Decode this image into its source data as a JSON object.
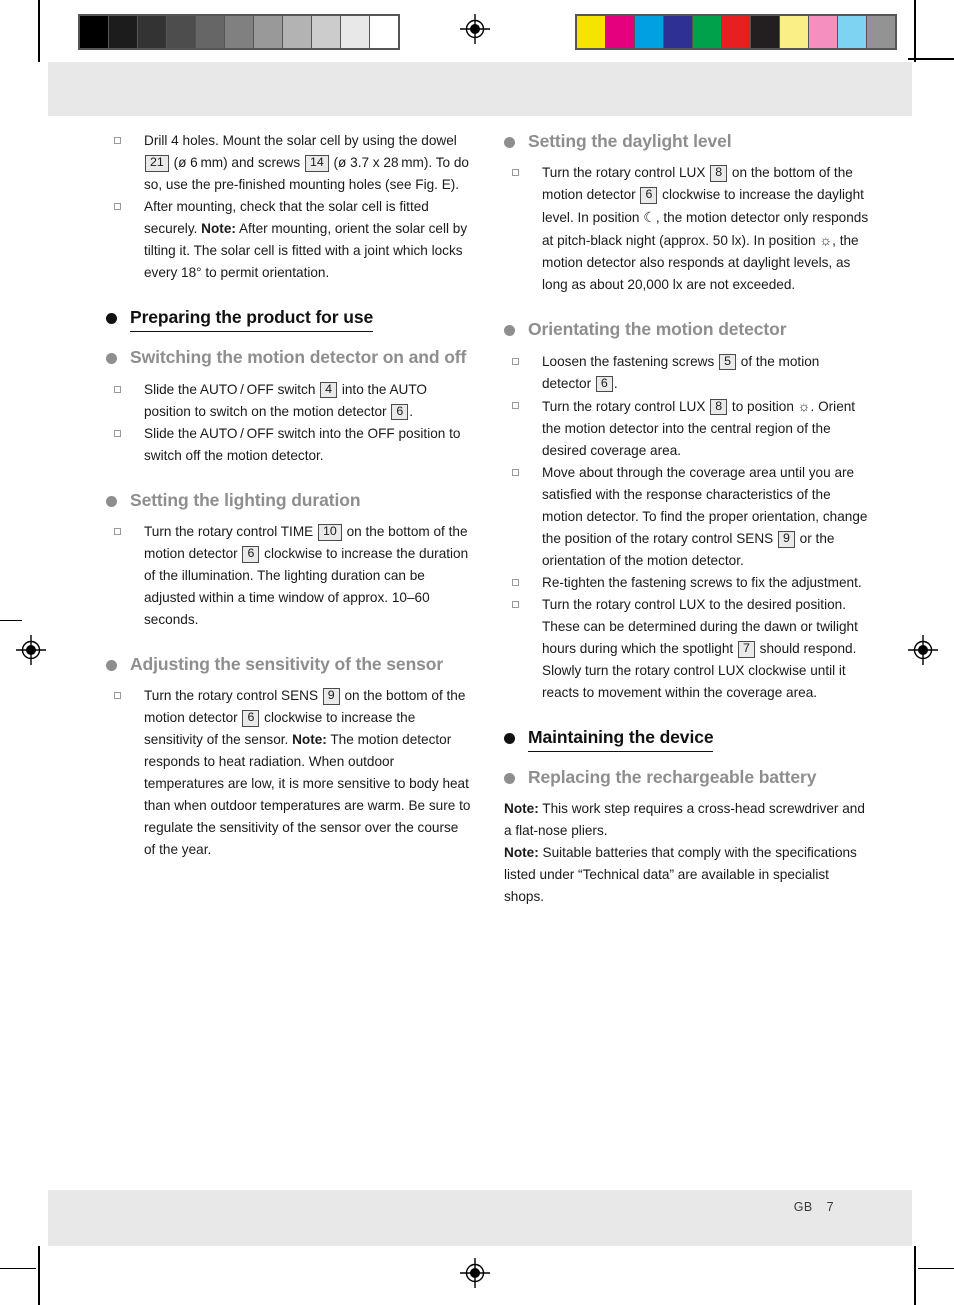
{
  "print_marks": {
    "gray_wedge": {
      "name": "grayscale-step-wedge",
      "swatches": [
        "#000000",
        "#1c1c1c",
        "#333333",
        "#4d4d4d",
        "#666666",
        "#808080",
        "#999999",
        "#b3b3b3",
        "#cccccc",
        "#e8e8e8",
        "#ffffff"
      ]
    },
    "color_bar": {
      "name": "cmyk-color-control-bar",
      "swatches": [
        "#f5e400",
        "#e5007d",
        "#00a0e3",
        "#2e3191",
        "#00a14b",
        "#e62020",
        "#231f20",
        "#faef86",
        "#f48fc0",
        "#7fd3f2",
        "#939393"
      ]
    },
    "registration_mark": "registration-target"
  },
  "left_column": [
    {
      "type": "list",
      "items": [
        {
          "segments": [
            {
              "t": "Drill 4 holes. Mount the solar cell by using the dowel "
            },
            {
              "ref": "21"
            },
            {
              "t": " (ø 6 mm) and screws "
            },
            {
              "ref": "14"
            },
            {
              "t": " (ø 3.7 x 28 mm). To do so, use the pre-finished mounting holes (see Fig. E)."
            }
          ]
        },
        {
          "segments": [
            {
              "t": "After mounting, check that the solar cell is fitted securely. "
            },
            {
              "b": "Note:"
            },
            {
              "t": " After mounting, orient the solar cell by tilting it. The solar cell is fitted with a joint which locks every 18° to permit orientation."
            }
          ]
        }
      ]
    },
    {
      "type": "heading1",
      "text": "Preparing the product for use"
    },
    {
      "type": "heading2",
      "text": "Switching the motion detector on and off"
    },
    {
      "type": "list",
      "items": [
        {
          "segments": [
            {
              "t": "Slide the AUTO / OFF switch "
            },
            {
              "ref": "4"
            },
            {
              "t": " into the AUTO position to switch on the motion detector "
            },
            {
              "ref": "6"
            },
            {
              "t": "."
            }
          ]
        },
        {
          "segments": [
            {
              "t": "Slide the AUTO / OFF switch into the OFF position to switch off the motion detector."
            }
          ]
        }
      ]
    },
    {
      "type": "heading2",
      "text": "Setting the lighting duration"
    },
    {
      "type": "list",
      "items": [
        {
          "segments": [
            {
              "t": "Turn the rotary control TIME "
            },
            {
              "ref": "10"
            },
            {
              "t": " on the bottom of the motion detector "
            },
            {
              "ref": "6"
            },
            {
              "t": " clockwise to increase the duration of the illumination. The lighting duration can be adjusted within a time window of approx. 10–60 seconds."
            }
          ]
        }
      ]
    },
    {
      "type": "heading2",
      "text": "Adjusting the sensitivity of the sensor"
    },
    {
      "type": "list",
      "items": [
        {
          "segments": [
            {
              "t": "Turn the rotary control SENS "
            },
            {
              "ref": "9"
            },
            {
              "t": " on the bottom of the motion detector "
            },
            {
              "ref": "6"
            },
            {
              "t": " clockwise to increase the sensitivity of the sensor. "
            },
            {
              "b": "Note:"
            },
            {
              "t": " The motion detector responds to heat radiation. When outdoor temperatures are low, it is more sensitive to body heat than when outdoor temperatures are warm. Be sure to regulate the sensitivity of the sensor over the course of the year."
            }
          ]
        }
      ]
    }
  ],
  "right_column": [
    {
      "type": "heading2",
      "text": "Setting the daylight level"
    },
    {
      "type": "list",
      "items": [
        {
          "segments": [
            {
              "t": "Turn the rotary control LUX "
            },
            {
              "ref": "8"
            },
            {
              "t": " on the bottom of the motion detector "
            },
            {
              "ref": "6"
            },
            {
              "t": " clockwise to increase the daylight level. In position "
            },
            {
              "g": "☾"
            },
            {
              "t": ", the motion detector only responds at pitch-black night (approx. 50 lx). In position "
            },
            {
              "g": "☼"
            },
            {
              "t": ", the motion detector also responds at daylight levels, as long as about 20,000 lx are not exceeded."
            }
          ]
        }
      ]
    },
    {
      "type": "heading2",
      "text": "Orientating the motion detector"
    },
    {
      "type": "list",
      "items": [
        {
          "segments": [
            {
              "t": "Loosen the fastening screws "
            },
            {
              "ref": "5"
            },
            {
              "t": " of the motion detector "
            },
            {
              "ref": "6"
            },
            {
              "t": "."
            }
          ]
        },
        {
          "segments": [
            {
              "t": "Turn the rotary control LUX "
            },
            {
              "ref": "8"
            },
            {
              "t": " to position "
            },
            {
              "g": "☼"
            },
            {
              "t": ". Orient the motion detector into the central region of the desired coverage area."
            }
          ]
        },
        {
          "segments": [
            {
              "t": "Move about through the coverage area until you are satisfied with the response characteristics of the motion detector. To find the proper orientation, change the position of the rotary control SENS "
            },
            {
              "ref": "9"
            },
            {
              "t": " or the orientation of the motion detector."
            }
          ]
        },
        {
          "segments": [
            {
              "t": "Re-tighten the fastening screws to fix the adjustment."
            }
          ]
        },
        {
          "segments": [
            {
              "t": "Turn the rotary control LUX to the desired position. These can be determined during the dawn or twilight hours during which the spotlight "
            },
            {
              "ref": "7"
            },
            {
              "t": " should respond. Slowly turn the rotary control LUX clockwise until it reacts to movement within the coverage area."
            }
          ]
        }
      ]
    },
    {
      "type": "heading1",
      "text": "Maintaining the device"
    },
    {
      "type": "heading2",
      "text": "Replacing the rechargeable battery"
    },
    {
      "type": "paragraphs",
      "items": [
        {
          "segments": [
            {
              "b": "Note:"
            },
            {
              "t": " This work step requires a cross-head screwdriver and a flat-nose pliers."
            }
          ]
        },
        {
          "segments": [
            {
              "b": "Note:"
            },
            {
              "t": " Suitable batteries that comply with the specifications listed under “Technical data” are available in specialist shops."
            }
          ]
        }
      ]
    }
  ],
  "footer": {
    "locale": "GB",
    "page_number": "7"
  }
}
